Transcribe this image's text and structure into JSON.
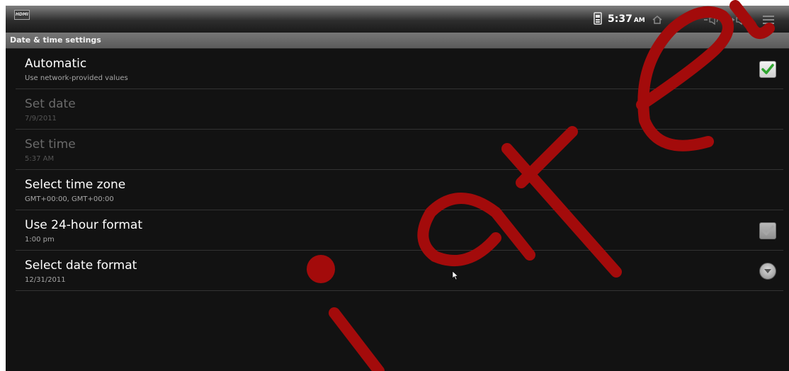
{
  "status_bar": {
    "hdmi_label": "HDMI",
    "time": "5:37",
    "ampm": "AM",
    "icons": [
      "sd-card-icon",
      "back-icon",
      "home-icon",
      "volume-down-icon",
      "volume-up-icon",
      "menu-icon"
    ]
  },
  "title_bar": {
    "title": "Date & time settings"
  },
  "settings": [
    {
      "title": "Automatic",
      "subtitle": "Use network-provided values",
      "enabled": true,
      "control": "checkbox",
      "checked": true
    },
    {
      "title": "Set date",
      "subtitle": "7/9/2011",
      "enabled": false,
      "control": "none"
    },
    {
      "title": "Set time",
      "subtitle": "5:37 AM",
      "enabled": false,
      "control": "none"
    },
    {
      "title": "Select time zone",
      "subtitle": "GMT+00:00, GMT+00:00",
      "enabled": true,
      "control": "none"
    },
    {
      "title": "Use 24-hour format",
      "subtitle": "1:00 pm",
      "enabled": true,
      "control": "checkbox",
      "checked": false
    },
    {
      "title": "Select date format",
      "subtitle": "12/31/2011",
      "enabled": true,
      "control": "spinner"
    }
  ],
  "colors": {
    "check_green": "#2fa52f",
    "watermark_red": "#a30b0b"
  }
}
